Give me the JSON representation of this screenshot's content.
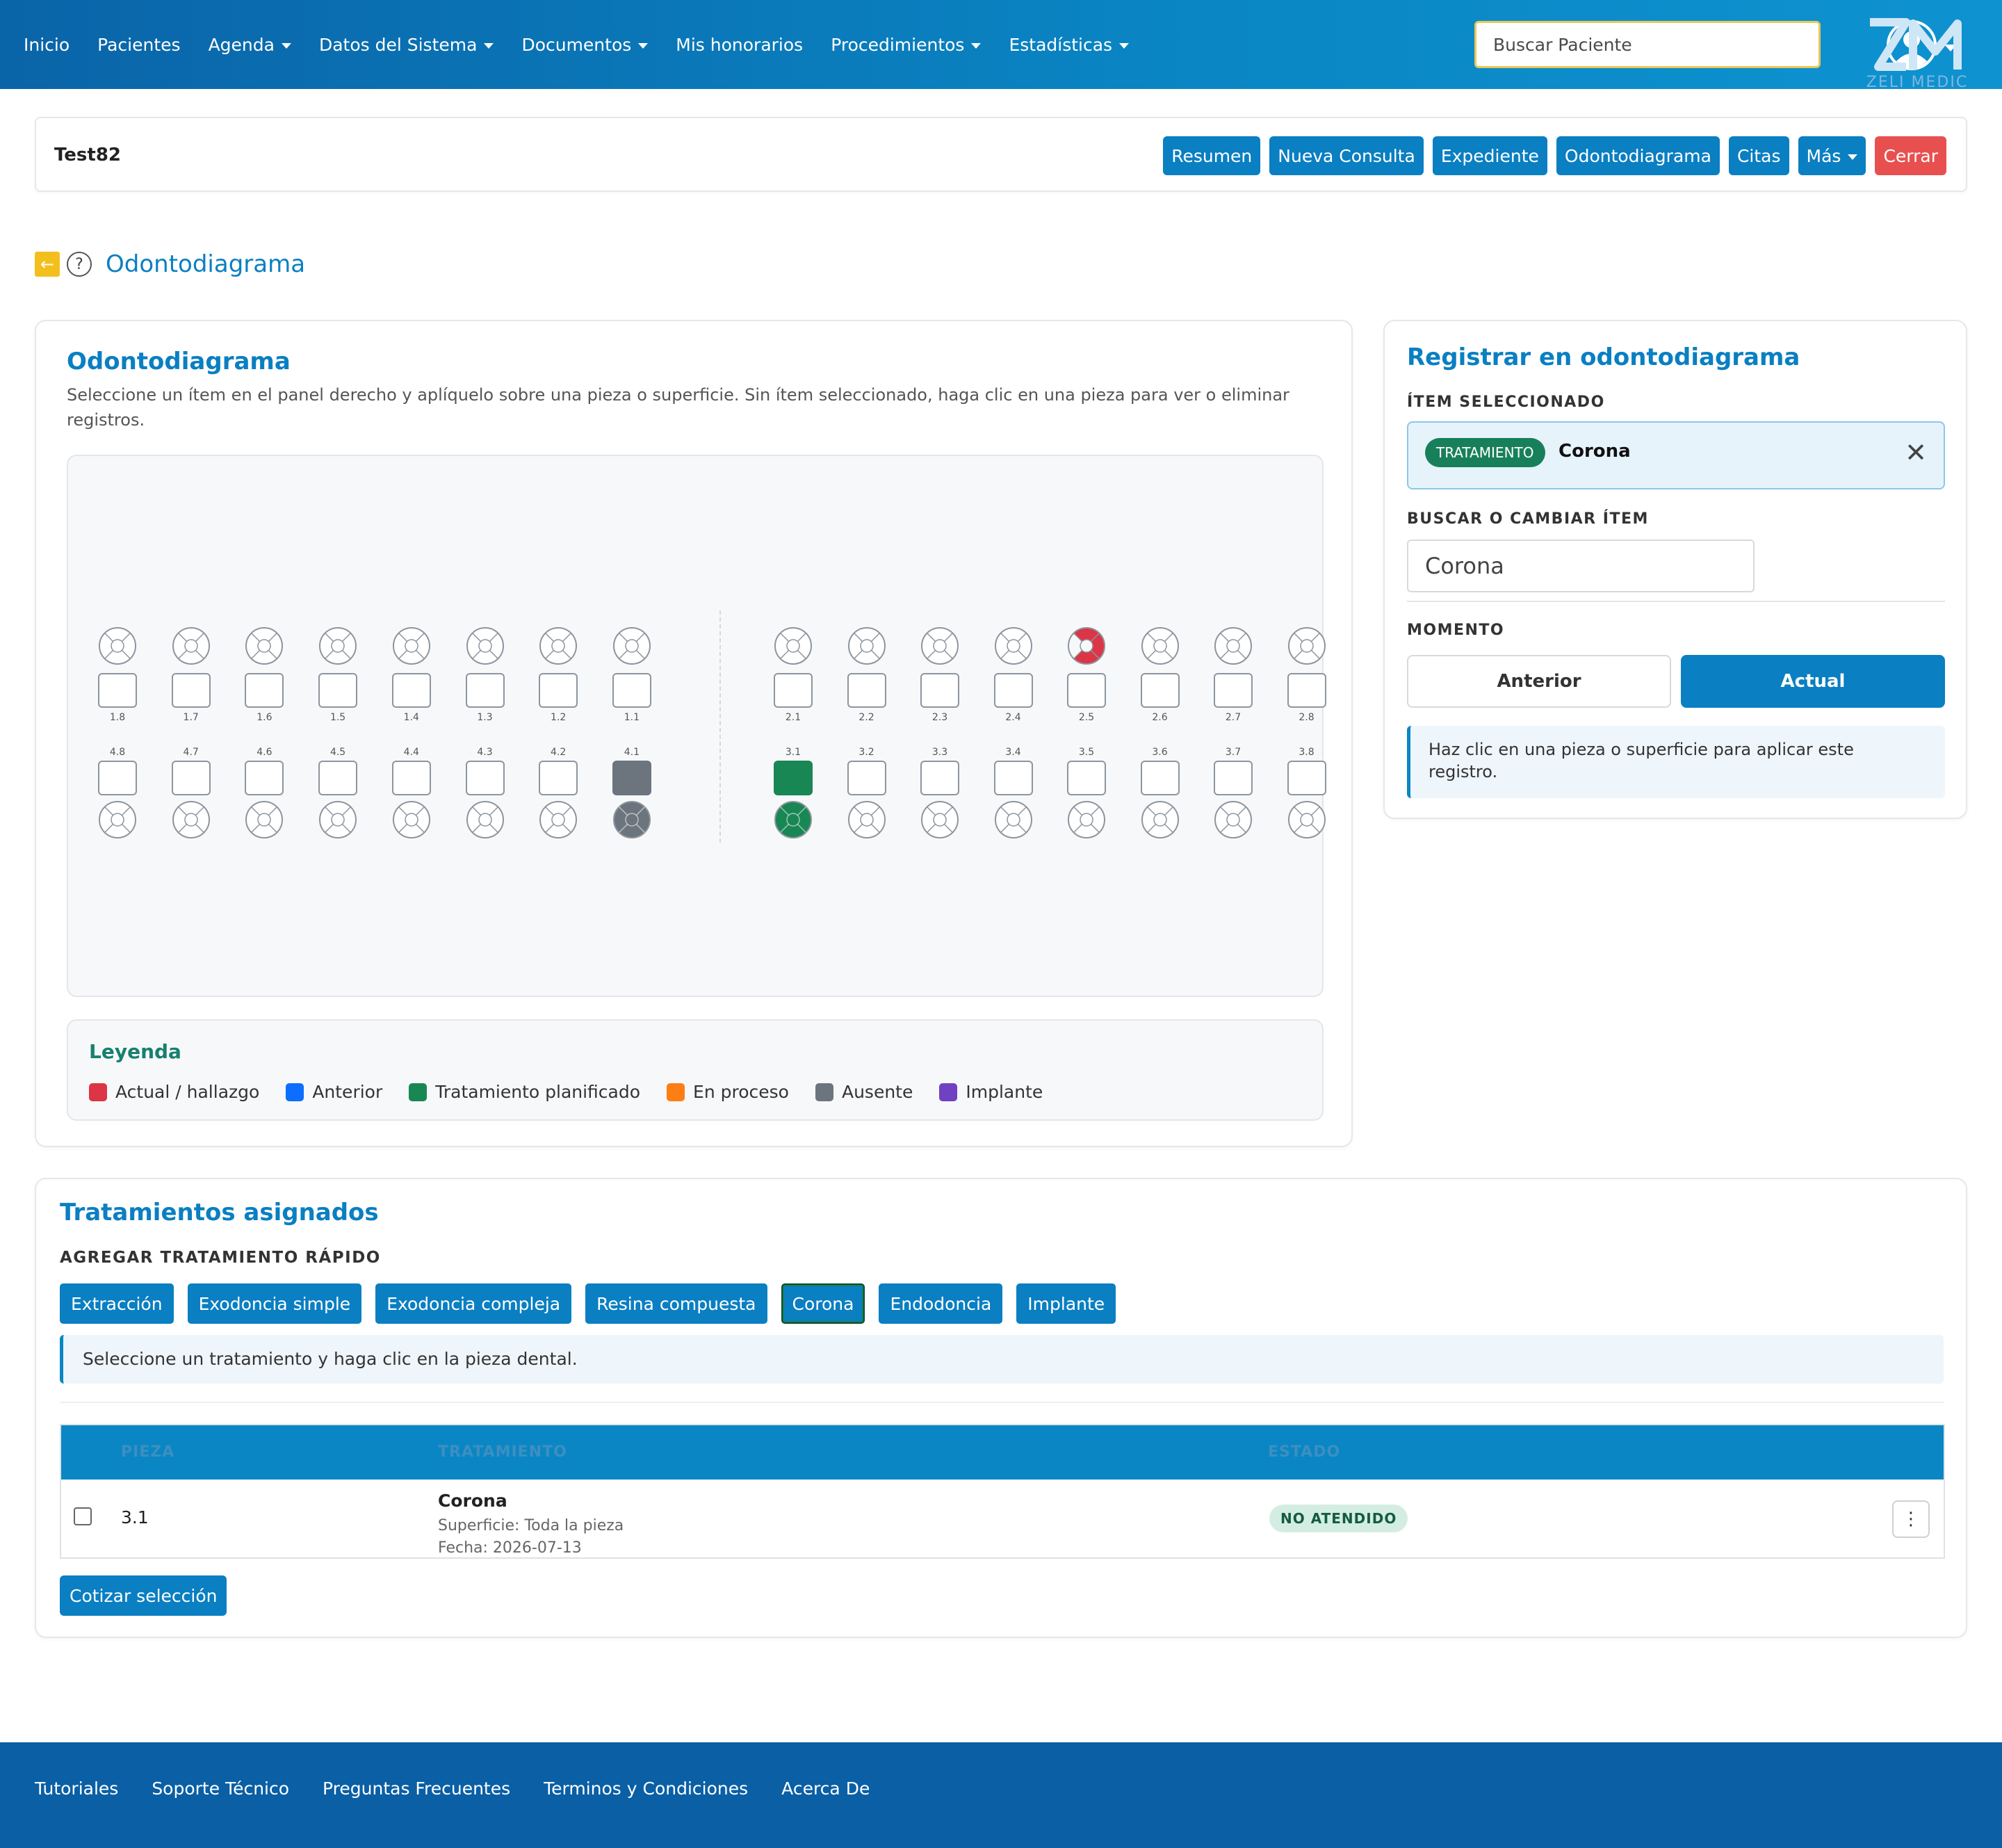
{
  "navbar": {
    "links": [
      {
        "label": "Inicio",
        "dropdown": false
      },
      {
        "label": "Pacientes",
        "dropdown": false
      },
      {
        "label": "Agenda",
        "dropdown": true
      },
      {
        "label": "Datos del Sistema",
        "dropdown": true
      },
      {
        "label": "Documentos",
        "dropdown": true
      },
      {
        "label": "Mis honorarios",
        "dropdown": false
      },
      {
        "label": "Procedimientos",
        "dropdown": true
      },
      {
        "label": "Estadísticas",
        "dropdown": true
      }
    ],
    "search_placeholder": "Buscar Paciente",
    "user_icon": "user-circle-icon"
  },
  "patient": {
    "name": "Test82",
    "actions": [
      "Resumen",
      "Nueva Consulta",
      "Expediente",
      "Odontodiagrama",
      "Citas",
      "Más",
      "Cerrar"
    ]
  },
  "page": {
    "title": "Odontodiagrama",
    "back_icon": "arrow-left-icon",
    "help_icon": "question-icon"
  },
  "odontogram": {
    "title": "Odontodiagrama",
    "description": "Seleccione un ítem en el panel derecho y aplíquelo sobre una pieza o superficie. Sin ítem seleccionado, haga clic en una pieza para ver o eliminar registros.",
    "upper": [
      "1.8",
      "1.7",
      "1.6",
      "1.5",
      "1.4",
      "1.3",
      "1.2",
      "1.1",
      "2.1",
      "2.2",
      "2.3",
      "2.4",
      "2.5",
      "2.6",
      "2.7",
      "2.8"
    ],
    "lower": [
      "4.8",
      "4.7",
      "4.6",
      "4.5",
      "4.4",
      "4.3",
      "4.2",
      "4.1",
      "3.1",
      "3.2",
      "3.3",
      "3.4",
      "3.5",
      "3.6",
      "3.7",
      "3.8"
    ],
    "marks": {
      "2.5": {
        "state": "actual",
        "surfaces": [
          "top",
          "right",
          "bottom"
        ]
      },
      "4.1": {
        "state": "ausente",
        "surfaces": [
          "full"
        ]
      },
      "3.1": {
        "state": "planificado",
        "surfaces": [
          "full"
        ]
      }
    },
    "colors": {
      "actual": "#dc3545",
      "anterior": "#0d6efd",
      "planificado": "#198754",
      "proceso": "#fd7e14",
      "ausente": "#6c757d",
      "implante": "#6f42c1"
    }
  },
  "legend": {
    "title": "Leyenda",
    "items": [
      {
        "label": "Actual / hallazgo",
        "color": "#dc3545"
      },
      {
        "label": "Anterior",
        "color": "#0d6efd"
      },
      {
        "label": "Tratamiento planificado",
        "color": "#198754"
      },
      {
        "label": "En proceso",
        "color": "#fd7e14"
      },
      {
        "label": "Ausente",
        "color": "#6c757d"
      },
      {
        "label": "Implante",
        "color": "#6f42c1"
      }
    ]
  },
  "side": {
    "title": "Registrar en odontodiagrama",
    "selected_label": "ÍTEM SELECCIONADO",
    "selected_badge": "TRATAMIENTO",
    "selected_name": "Corona",
    "search_label": "BUSCAR O CAMBIAR ÍTEM",
    "search_value": "Corona",
    "moment_label": "MOMENTO",
    "moment_anterior": "Anterior",
    "moment_actual": "Actual",
    "info": "Haz clic en una pieza o superficie para aplicar este registro."
  },
  "treatments": {
    "title": "Tratamientos asignados",
    "quick_label": "AGREGAR TRATAMIENTO RÁPIDO",
    "quick_buttons": [
      "Extracción",
      "Exodoncia simple",
      "Exodoncia compleja",
      "Resina compuesta",
      "Corona",
      "Endodoncia",
      "Implante"
    ],
    "active_button": "Corona",
    "info": "Seleccione un tratamiento y haga clic en la pieza dental.",
    "columns": {
      "pieza": "PIEZA",
      "tratamiento": "TRATAMIENTO",
      "estado": "ESTADO"
    },
    "rows": [
      {
        "pieza": "3.1",
        "tratamiento": "Corona",
        "superficie": "Superficie: Toda la pieza",
        "fecha": "Fecha: 2026-07-13",
        "estado": "NO ATENDIDO"
      }
    ],
    "quote_button": "Cotizar selección"
  },
  "footer": {
    "links": [
      "Tutoriales",
      "Soporte Técnico",
      "Preguntas Frecuentes",
      "Terminos y Condiciones",
      "Acerca De"
    ],
    "logo_text": "ZELI MEDIC"
  }
}
